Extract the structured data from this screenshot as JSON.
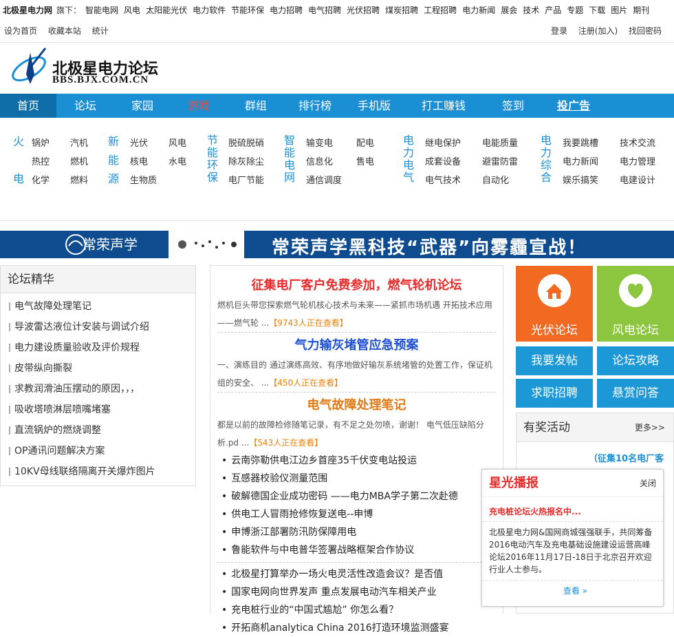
{
  "topbar": {
    "brand": "北极星电力网",
    "under": "旗下：",
    "links": [
      "智能电网",
      "风电",
      "太阳能光伏",
      "电力软件",
      "节能环保",
      "电力招聘",
      "电气招聘",
      "光伏招聘",
      "煤炭招聘",
      "工程招聘",
      "电力新闻",
      "展会",
      "技术",
      "产品",
      "专题",
      "下载",
      "图片",
      "期刊"
    ]
  },
  "bar2": {
    "left": [
      "设为首页",
      "收藏本站",
      "统计"
    ],
    "right": [
      "登录",
      "注册(加入)",
      "找回密码"
    ]
  },
  "logo": {
    "cn": "北极星电力论坛",
    "en": "BBS.BJX.COM.CN"
  },
  "nav": [
    {
      "label": "首页"
    },
    {
      "label": "论坛"
    },
    {
      "label": "家园"
    },
    {
      "label": "游戏"
    },
    {
      "label": "群组"
    },
    {
      "label": "排行榜"
    },
    {
      "label": "手机版"
    },
    {
      "label": "打工赚钱"
    },
    {
      "label": "签到"
    },
    {
      "label": "投广告"
    }
  ],
  "cats": {
    "huodian": {
      "title1": "火",
      "title2": "电",
      "items": [
        "锅炉",
        "汽机",
        "热控",
        "燃机",
        "化学",
        "燃料"
      ]
    },
    "xinnengyuan": {
      "title": [
        "新",
        "能",
        "源"
      ],
      "items": [
        "光伏",
        "风电",
        "核电",
        "水电",
        "生物质"
      ]
    },
    "jieneng": {
      "title": [
        "节",
        "能",
        "环",
        "保"
      ],
      "items": [
        "脱硫脱硝",
        "除灰除尘",
        "电厂节能"
      ]
    },
    "zhineng": {
      "title": [
        "智",
        "能",
        "电",
        "网"
      ],
      "items": [
        "输变电",
        "配电",
        "信息化",
        "售电",
        "通信调度"
      ]
    },
    "dianqi": {
      "title": [
        "电",
        "力",
        "电",
        "气"
      ],
      "items": [
        "继电保护",
        "电能质量",
        "成套设备",
        "避雷防雷",
        "电气技术",
        "自动化"
      ]
    },
    "zonghe": {
      "title": [
        "电",
        "力",
        "综",
        "合"
      ],
      "items": [
        "我要跳槽",
        "技术交流",
        "电力新闻",
        "电力管理",
        "娱乐搞笑",
        "电建设计"
      ]
    }
  },
  "banner": {
    "brand": "常荣声学",
    "slogan": "常荣声学黑科技“武器”向雾霾宣战！"
  },
  "left": {
    "title": "论坛精华",
    "items": [
      "电气故障处理笔记",
      "导波雷达液位计安装与调试介绍",
      "电力建设质量验收及评价规程",
      "皮带纵向撕裂",
      "求教润滑油压摆动的原因，，，",
      "吸收塔喷淋层喷嘴堵塞",
      "直流锅炉的燃烧调整",
      "OP通讯问题解决方案",
      "10KV母线联络隔离开关爆炸图片"
    ]
  },
  "center": {
    "articles": [
      {
        "title": "征集电厂客户免费参加，燃气轮机论坛",
        "color": "#e52b2b",
        "desc": "燃机巨头带您探索燃气轮机核心技术与未来——紧抓市场机遇 开拓技术应用 ——燃气轮 ...",
        "count": "【9743人正在查看】"
      },
      {
        "title": "气力输灰堵管应急预案",
        "color": "#1d4fd0",
        "desc": "一、演练目的 通过演练高效、有序地做好输灰系统堵管的处置工作，保证机组的安全、 ...",
        "count": "【450人正在查看】"
      },
      {
        "title": "电气故障处理笔记",
        "color": "#e07a14",
        "desc": "都是以前的故障检修随笔记录，有不足之处勿喷，谢谢！ 电气低压缺陷分析.pd ...",
        "count": "【543人正在查看】"
      }
    ],
    "news1": [
      "云南弥勒供电江边乡首座35千伏变电站投运",
      "互感器校验仪测量范围",
      "破解德国企业成功密码 ——电力MBA学子第二次赴德",
      "供电工人冒雨抢修恢复送电--申博",
      "申博浙江部署防汛防保障用电",
      "鲁能软件与中电普华签署战略框架合作协议"
    ],
    "news2": [
      "北极星打算举办一场火电灵活性改造会议？是否值",
      "国家电网向世界发声 重点发展电动汽车相关产业",
      "充电桩行业的“中国式尴尬” 你怎么看？",
      "开拓商机analytica China 2016打造环境监测盛宴"
    ]
  },
  "tiles": {
    "pv": "光伏论坛",
    "wind": "风电论坛",
    "post": "我要发帖",
    "guide": "论坛攻略",
    "job": "求职招聘",
    "reward": "悬赏问答"
  },
  "activity": {
    "title": "有奖活动",
    "more": "更多>>",
    "text": "（征集10名电厂客"
  },
  "popup": {
    "title": "星光播报",
    "close": "关闭",
    "headline": "充电桩论坛火热报名中...",
    "body": "北极星电力网&国网商城强强联手，共同筹备2016电动汽车及充电基础设施建设运营高峰论坛2016年11月17日-18日于北京召开欢迎行业人士参与。",
    "more": "查看 »"
  },
  "colors": {
    "nav": "#1a8fd4",
    "orange": "#f26a21",
    "green": "#8cc63e",
    "blue": "#1b98d5"
  }
}
